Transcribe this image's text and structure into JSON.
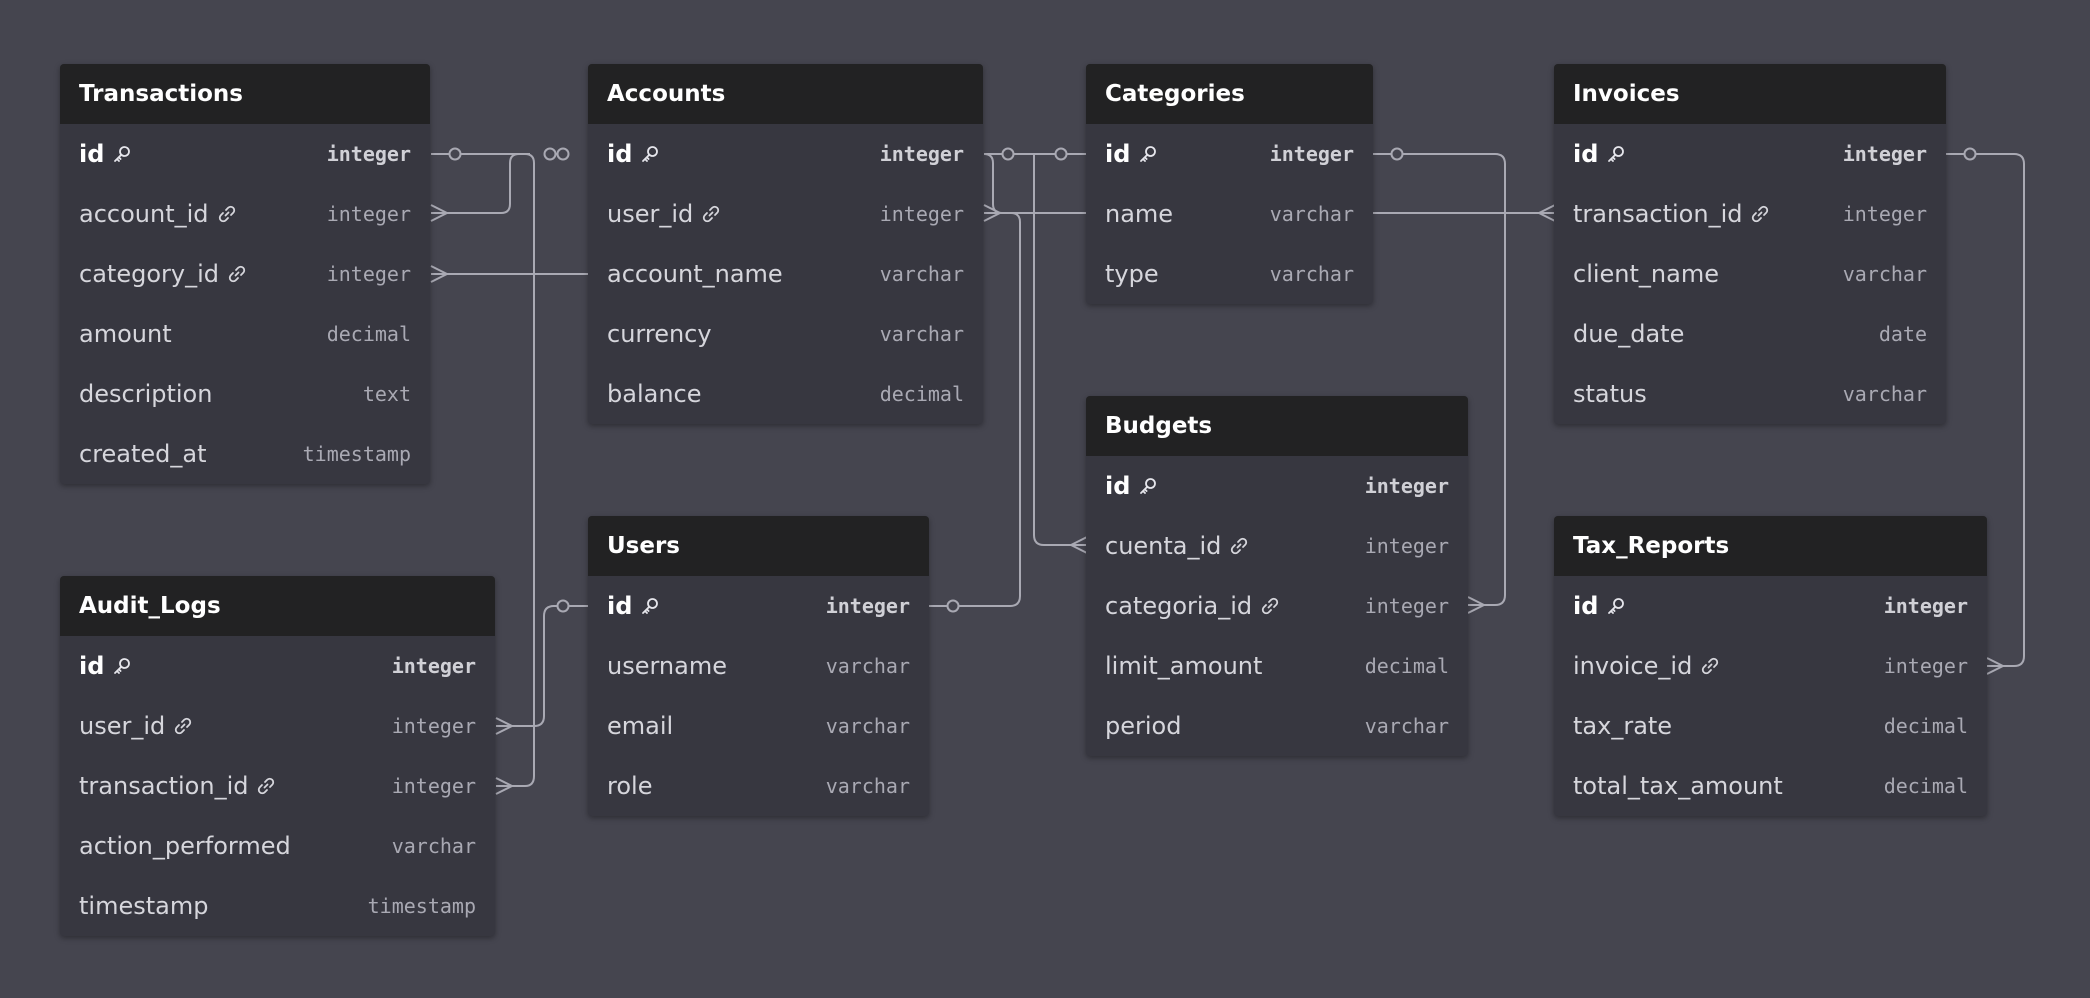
{
  "diagram": {
    "tables": [
      {
        "id": "transactions",
        "name": "Transactions",
        "fields": [
          {
            "name": "id",
            "type": "integer",
            "pk": true
          },
          {
            "name": "account_id",
            "type": "integer",
            "fk": true
          },
          {
            "name": "category_id",
            "type": "integer",
            "fk": true
          },
          {
            "name": "amount",
            "type": "decimal"
          },
          {
            "name": "description",
            "type": "text"
          },
          {
            "name": "created_at",
            "type": "timestamp"
          }
        ]
      },
      {
        "id": "accounts",
        "name": "Accounts",
        "fields": [
          {
            "name": "id",
            "type": "integer",
            "pk": true
          },
          {
            "name": "user_id",
            "type": "integer",
            "fk": true
          },
          {
            "name": "account_name",
            "type": "varchar"
          },
          {
            "name": "currency",
            "type": "varchar"
          },
          {
            "name": "balance",
            "type": "decimal"
          }
        ]
      },
      {
        "id": "categories",
        "name": "Categories",
        "fields": [
          {
            "name": "id",
            "type": "integer",
            "pk": true
          },
          {
            "name": "name",
            "type": "varchar"
          },
          {
            "name": "type",
            "type": "varchar"
          }
        ]
      },
      {
        "id": "invoices",
        "name": "Invoices",
        "fields": [
          {
            "name": "id",
            "type": "integer",
            "pk": true
          },
          {
            "name": "transaction_id",
            "type": "integer",
            "fk": true
          },
          {
            "name": "client_name",
            "type": "varchar"
          },
          {
            "name": "due_date",
            "type": "date"
          },
          {
            "name": "status",
            "type": "varchar"
          }
        ]
      },
      {
        "id": "budgets",
        "name": "Budgets",
        "fields": [
          {
            "name": "id",
            "type": "integer",
            "pk": true
          },
          {
            "name": "cuenta_id",
            "type": "integer",
            "fk": true
          },
          {
            "name": "categoria_id",
            "type": "integer",
            "fk": true
          },
          {
            "name": "limit_amount",
            "type": "decimal"
          },
          {
            "name": "period",
            "type": "varchar"
          }
        ]
      },
      {
        "id": "users",
        "name": "Users",
        "fields": [
          {
            "name": "id",
            "type": "integer",
            "pk": true
          },
          {
            "name": "username",
            "type": "varchar"
          },
          {
            "name": "email",
            "type": "varchar"
          },
          {
            "name": "role",
            "type": "varchar"
          }
        ]
      },
      {
        "id": "audit_logs",
        "name": "Audit_Logs",
        "fields": [
          {
            "name": "id",
            "type": "integer",
            "pk": true
          },
          {
            "name": "user_id",
            "type": "integer",
            "fk": true
          },
          {
            "name": "transaction_id",
            "type": "integer",
            "fk": true
          },
          {
            "name": "action_performed",
            "type": "varchar"
          },
          {
            "name": "timestamp",
            "type": "timestamp"
          }
        ]
      },
      {
        "id": "tax_reports",
        "name": "Tax_Reports",
        "fields": [
          {
            "name": "id",
            "type": "integer",
            "pk": true
          },
          {
            "name": "invoice_id",
            "type": "integer",
            "fk": true
          },
          {
            "name": "tax_rate",
            "type": "decimal"
          },
          {
            "name": "total_tax_amount",
            "type": "decimal"
          }
        ]
      }
    ],
    "relationships": [
      {
        "from": "transactions.account_id",
        "to": "accounts.id",
        "cardinality": "many-to-one"
      },
      {
        "from": "transactions.category_id",
        "to": "categories.id",
        "cardinality": "many-to-one"
      },
      {
        "from": "accounts.user_id",
        "to": "users.id",
        "cardinality": "many-to-one"
      },
      {
        "from": "invoices.transaction_id",
        "to": "transactions.id",
        "cardinality": "many-to-one"
      },
      {
        "from": "budgets.cuenta_id",
        "to": "accounts.id",
        "cardinality": "many-to-one"
      },
      {
        "from": "budgets.categoria_id",
        "to": "categories.id",
        "cardinality": "many-to-one"
      },
      {
        "from": "audit_logs.user_id",
        "to": "users.id",
        "cardinality": "many-to-one"
      },
      {
        "from": "audit_logs.transaction_id",
        "to": "transactions.id",
        "cardinality": "many-to-one"
      },
      {
        "from": "tax_reports.invoice_id",
        "to": "invoices.id",
        "cardinality": "many-to-one"
      }
    ],
    "icons": {
      "primary_key": "key-icon",
      "foreign_key": "link-icon"
    },
    "colors": {
      "background": "#45454f",
      "table_header": "#222223",
      "table_body": "#373740",
      "edge": "#a9a9b3"
    }
  }
}
